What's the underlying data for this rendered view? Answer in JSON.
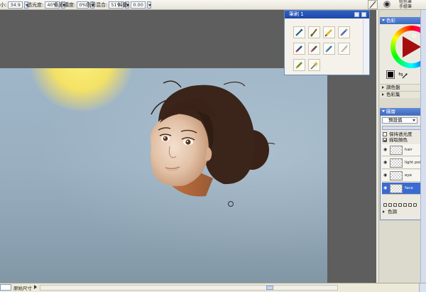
{
  "options_bar": {
    "size_label": "小:",
    "size_value": "34.9",
    "opacity_label": "透光度:",
    "opacity_value": "40%",
    "color_conc_label": "色彩濃度:",
    "color_conc_value": "0%",
    "color_mix_label": "色彩混合:",
    "color_mix_value": "51%",
    "jitter_label": "抖動:",
    "jitter_value": "0.00",
    "right_text_1": "組色筆",
    "right_text_2": "手繪筆"
  },
  "tools_palette": {
    "title": "筆刷 1",
    "tools": [
      "pen-icon",
      "brush-icon",
      "pencil-icon",
      "airbrush-icon",
      "marker-icon",
      "eraser-icon",
      "blender-icon",
      "calligraphy-icon",
      "crayon-icon",
      "special-brush-icon"
    ]
  },
  "color_panel": {
    "title": "色彩",
    "sub_1": "調色盤",
    "sub_2": "色彩集"
  },
  "layers_panel": {
    "title": "圖層",
    "blend_mode": "預設值",
    "preserve_label": "保持透光度",
    "mask_label": "描取顏色",
    "layers": [
      {
        "name": "hair",
        "selected": false
      },
      {
        "name": "light point",
        "selected": false
      },
      {
        "name": "eye",
        "selected": false
      },
      {
        "name": "face",
        "selected": true
      }
    ],
    "footer": "色調"
  },
  "status_bar": {
    "text": "原始尺寸"
  },
  "colors": {
    "accent": "#3b6bd0",
    "canvas_bg": "#5e5e5e",
    "sky": "#9fb6c8",
    "sun": "#fbf07a"
  }
}
